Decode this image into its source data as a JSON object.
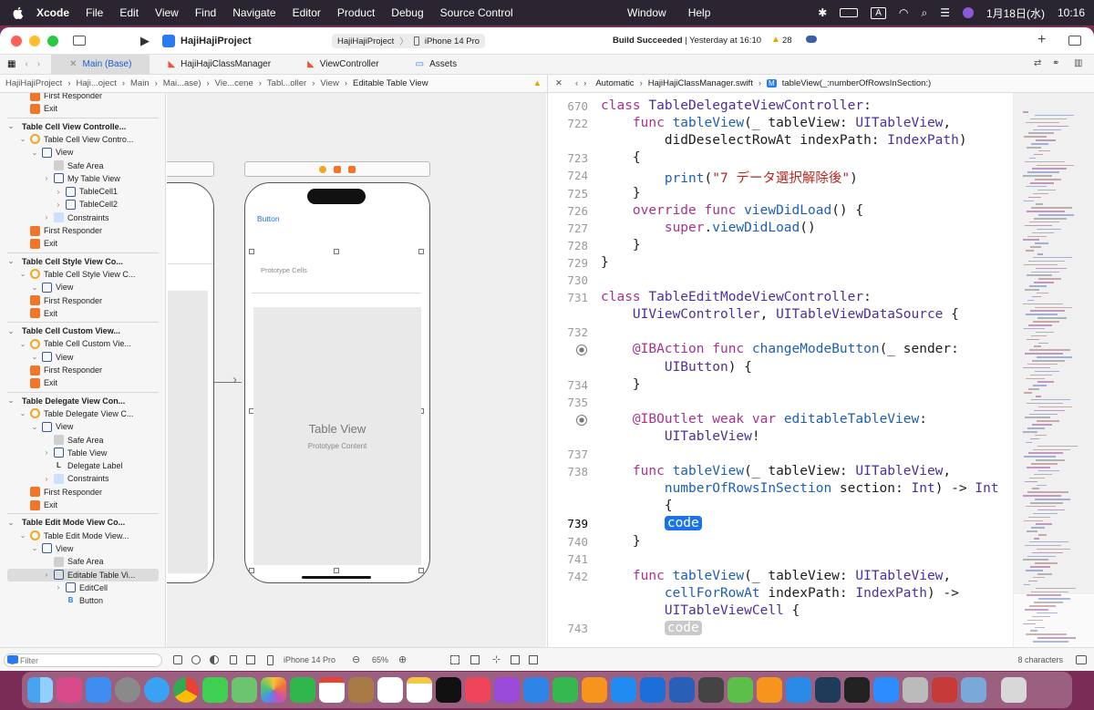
{
  "menubar": {
    "app": "Xcode",
    "items": [
      "File",
      "Edit",
      "View",
      "Find",
      "Navigate",
      "Editor",
      "Product",
      "Debug",
      "Source Control"
    ],
    "center": [
      "Window",
      "Help"
    ],
    "input_mode": "A",
    "date": "1月18日(水)",
    "time": "10:16"
  },
  "toolbar": {
    "project": "HajiHajiProject",
    "scheme": "HajiHajiProject",
    "device": "iPhone 14 Pro",
    "status_bold": "Build Succeeded",
    "status_time": "Yesterday at 16:10",
    "warnings": "28"
  },
  "tabs": [
    "Main (Base)",
    "HajiHajiClassManager",
    "ViewController",
    "Assets"
  ],
  "jump_left": [
    "HajiHajiProject",
    "Haji...oject",
    "Main",
    "Mai...ase)",
    "Vie...cene",
    "Tabl...oller",
    "View",
    "Editable Table View"
  ],
  "jump_right": [
    "Automatic",
    "HajiHajiClassManager.swift",
    "tableView(_:numberOfRowsInSection:)"
  ],
  "navigator": [
    {
      "label": "First Responder",
      "indent": 1,
      "icon": "first-responder"
    },
    {
      "label": "Exit",
      "indent": 1,
      "icon": "exit"
    },
    {
      "label": "Table Cell View Controlle...",
      "indent": 0,
      "icon": "scene",
      "header": true
    },
    {
      "label": "Table Cell View Contro...",
      "indent": 1,
      "icon": "controller"
    },
    {
      "label": "View",
      "indent": 2,
      "icon": "view"
    },
    {
      "label": "Safe Area",
      "indent": 3,
      "icon": "safe-area"
    },
    {
      "label": "My Table View",
      "indent": 3,
      "icon": "table"
    },
    {
      "label": "TableCell1",
      "indent": 4,
      "icon": "cell"
    },
    {
      "label": "TableCell2",
      "indent": 4,
      "icon": "cell"
    },
    {
      "label": "Constraints",
      "indent": 3,
      "icon": "constraints"
    },
    {
      "label": "First Responder",
      "indent": 1,
      "icon": "first-responder"
    },
    {
      "label": "Exit",
      "indent": 1,
      "icon": "exit"
    },
    {
      "label": "Table Cell Style View Co...",
      "indent": 0,
      "icon": "scene",
      "header": true
    },
    {
      "label": "Table Cell Style View C...",
      "indent": 1,
      "icon": "controller"
    },
    {
      "label": "View",
      "indent": 2,
      "icon": "view"
    },
    {
      "label": "First Responder",
      "indent": 1,
      "icon": "first-responder"
    },
    {
      "label": "Exit",
      "indent": 1,
      "icon": "exit"
    },
    {
      "label": "Table Cell Custom View...",
      "indent": 0,
      "icon": "scene",
      "header": true
    },
    {
      "label": "Table Cell Custom Vie...",
      "indent": 1,
      "icon": "controller"
    },
    {
      "label": "View",
      "indent": 2,
      "icon": "view"
    },
    {
      "label": "First Responder",
      "indent": 1,
      "icon": "first-responder"
    },
    {
      "label": "Exit",
      "indent": 1,
      "icon": "exit"
    },
    {
      "label": "Table Delegate View Con...",
      "indent": 0,
      "icon": "scene",
      "header": true
    },
    {
      "label": "Table Delegate View C...",
      "indent": 1,
      "icon": "controller"
    },
    {
      "label": "View",
      "indent": 2,
      "icon": "view"
    },
    {
      "label": "Safe Area",
      "indent": 3,
      "icon": "safe-area"
    },
    {
      "label": "Table View",
      "indent": 3,
      "icon": "table"
    },
    {
      "label": "Delegate Label",
      "indent": 3,
      "icon": "label"
    },
    {
      "label": "Constraints",
      "indent": 3,
      "icon": "constraints"
    },
    {
      "label": "First Responder",
      "indent": 1,
      "icon": "first-responder"
    },
    {
      "label": "Exit",
      "indent": 1,
      "icon": "exit"
    },
    {
      "label": "Table Edit Mode View Co...",
      "indent": 0,
      "icon": "scene",
      "header": true
    },
    {
      "label": "Table Edit Mode View...",
      "indent": 1,
      "icon": "controller"
    },
    {
      "label": "View",
      "indent": 2,
      "icon": "view"
    },
    {
      "label": "Safe Area",
      "indent": 3,
      "icon": "safe-area"
    },
    {
      "label": "Editable Table Vi...",
      "indent": 3,
      "icon": "table",
      "selected": true
    },
    {
      "label": "EditCell",
      "indent": 4,
      "icon": "cell"
    },
    {
      "label": "Button",
      "indent": 4,
      "icon": "button"
    }
  ],
  "filter_placeholder": "Filter",
  "canvas": {
    "button_label": "Button",
    "prototype_cells": "Prototype Cells",
    "table_view": "Table View",
    "prototype_content": "Prototype Content",
    "device": "iPhone 14 Pro",
    "zoom": "65%"
  },
  "code_lines": [
    {
      "n": "670",
      "html": "<span class='kw'>class</span> <span class='ty'>TableDelegateViewController</span>:"
    },
    {
      "n": "722",
      "html": "    <span class='kw'>func</span> <span class='fn'>tableView</span>(_ tableView: <span class='ty'>UITableView</span>,"
    },
    {
      "n": "",
      "html": "        didDeselectRowAt indexPath: <span class='ty'>IndexPath</span>)"
    },
    {
      "n": "723",
      "html": "    {"
    },
    {
      "n": "724",
      "html": "        <span class='fn'>print</span>(<span class='st'>\"7 データ選択解除後\"</span>)"
    },
    {
      "n": "725",
      "html": "    }"
    },
    {
      "n": "726",
      "html": "    <span class='kw'>override func</span> <span class='fn'>viewDidLoad</span>() {"
    },
    {
      "n": "727",
      "html": "        <span class='kw'>super</span>.<span class='fn'>viewDidLoad</span>()"
    },
    {
      "n": "728",
      "html": "    }"
    },
    {
      "n": "729",
      "html": "}"
    },
    {
      "n": "730",
      "html": ""
    },
    {
      "n": "731",
      "html": "<span class='kw'>class</span> <span class='ty'>TableEditModeViewController</span>:"
    },
    {
      "n": "",
      "html": "    <span class='ty'>UIViewController</span>, <span class='ty'>UITableViewDataSource</span> {"
    },
    {
      "n": "732",
      "html": ""
    },
    {
      "n": "",
      "html": "    <span class='at'>@IBAction</span> <span class='kw'>func</span> <span class='fn'>changeModeButton</span>(_ sender:"
    },
    {
      "n": "",
      "html": "        <span class='ty'>UIButton</span>) {"
    },
    {
      "n": "734",
      "html": "    }"
    },
    {
      "n": "735",
      "html": ""
    },
    {
      "n": "",
      "html": "    <span class='at'>@IBOutlet</span> <span class='kw'>weak var</span> <span class='fn'>editableTableView</span>:"
    },
    {
      "n": "",
      "html": "        <span class='ty'>UITableView</span>!"
    },
    {
      "n": "737",
      "html": ""
    },
    {
      "n": "738",
      "html": "    <span class='kw'>func</span> <span class='fn'>tableView</span>(_ tableView: <span class='ty'>UITableView</span>,"
    },
    {
      "n": "",
      "html": "        <span class='fn'>numberOfRowsInSection</span> section: <span class='ty'>Int</span>) -> <span class='ty'>Int</span>"
    },
    {
      "n": "",
      "html": "        {"
    },
    {
      "n": "739",
      "html": "        <span class='ph'>code</span>",
      "current": true
    },
    {
      "n": "740",
      "html": "    }"
    },
    {
      "n": "741",
      "html": ""
    },
    {
      "n": "742",
      "html": "    <span class='kw'>func</span> <span class='fn'>tableView</span>(_ tableView: <span class='ty'>UITableView</span>,"
    },
    {
      "n": "",
      "html": "        <span class='fn'>cellForRowAt</span> indexPath: <span class='ty'>IndexPath</span>) ->"
    },
    {
      "n": "",
      "html": "        <span class='ty'>UITableViewCell</span> {"
    },
    {
      "n": "743",
      "html": "        <span class='ph2'>code</span>"
    }
  ],
  "editor_status": "8 characters"
}
